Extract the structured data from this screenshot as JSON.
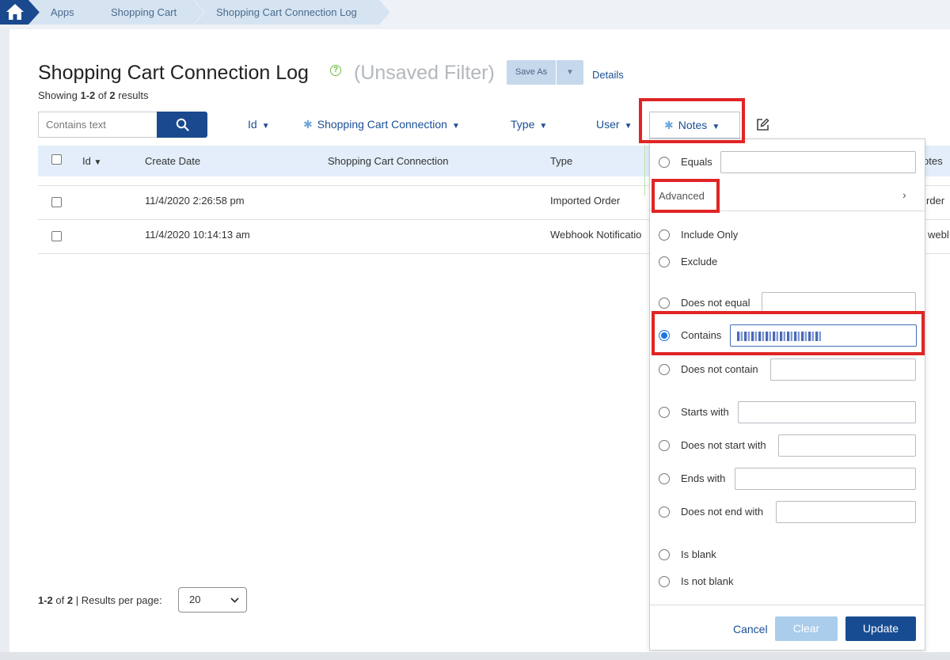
{
  "breadcrumb": {
    "items": [
      "Apps",
      "Shopping Cart",
      "Shopping Cart Connection Log"
    ]
  },
  "header": {
    "title": "Shopping Cart Connection Log",
    "unsaved": "(Unsaved Filter)",
    "save_as": "Save As",
    "details": "Details",
    "showing_prefix": "Showing ",
    "showing_range": "1-2",
    "showing_of": " of ",
    "showing_total": "2",
    "showing_suffix": " results"
  },
  "search": {
    "placeholder": "Contains text"
  },
  "filters": {
    "id": "Id",
    "shopping_cart_connection": "Shopping Cart Connection",
    "type": "Type",
    "user": "User",
    "notes": "Notes"
  },
  "table": {
    "columns": [
      "Id",
      "Create Date",
      "Shopping Cart Connection",
      "Type",
      "otes"
    ],
    "rows": [
      {
        "id": "",
        "create_date": "11/4/2020 2:26:58 pm",
        "connection": "",
        "type": "Imported Order",
        "notes": "rder"
      },
      {
        "id": "",
        "create_date": "11/4/2020 10:14:13 am",
        "connection": "",
        "type": "Webhook Notificatio",
        "notes": "webl"
      }
    ]
  },
  "footer": {
    "range": "1-2",
    "of": " of ",
    "total": "2",
    "results_per_page_label": " | Results per page:",
    "results_per_page": "20"
  },
  "notes_filter": {
    "equals": "Equals",
    "advanced": "Advanced",
    "options": {
      "include_only": "Include Only",
      "exclude": "Exclude",
      "does_not_equal": "Does not equal",
      "contains": "Contains",
      "does_not_contain": "Does not contain",
      "starts_with": "Starts with",
      "does_not_start_with": "Does not start with",
      "ends_with": "Ends with",
      "does_not_end_with": "Does not end with",
      "is_blank": "Is blank",
      "is_not_blank": "Is not blank"
    },
    "selected": "contains",
    "cancel": "Cancel",
    "clear": "Clear",
    "update": "Update"
  },
  "colors": {
    "primary": "#1a4a8d",
    "highlight": "#e02424",
    "accent": "#6cbf3d"
  }
}
